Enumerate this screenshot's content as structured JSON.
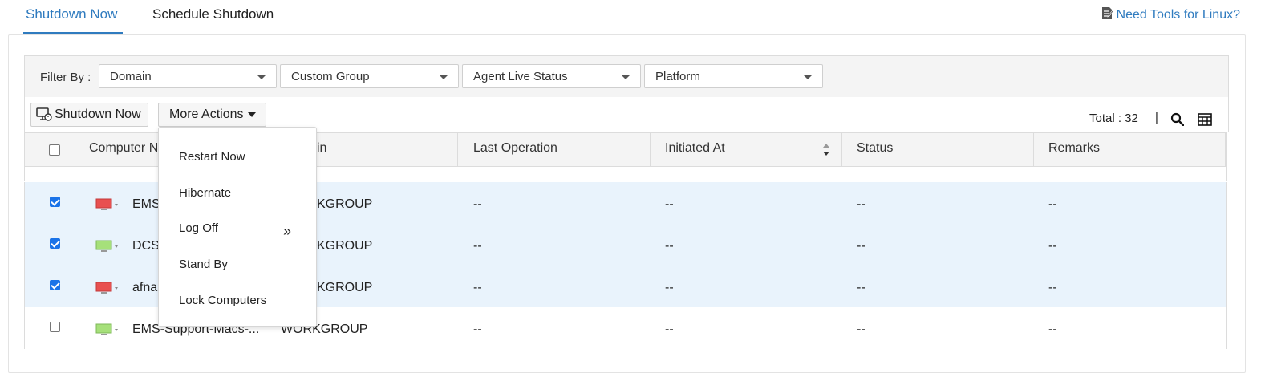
{
  "tabs": [
    {
      "label": "Shutdown Now",
      "active": true
    },
    {
      "label": "Schedule Shutdown",
      "active": false
    }
  ],
  "linux_link": {
    "label": "Need Tools for Linux?",
    "icon": "edit-note-icon"
  },
  "filter": {
    "label": "Filter By :",
    "selects": [
      {
        "value": "Domain"
      },
      {
        "value": "Custom Group"
      },
      {
        "value": "Agent Live Status"
      },
      {
        "value": "Platform"
      }
    ]
  },
  "actions": {
    "shutdown_label": "Shutdown Now",
    "more_label": "More Actions"
  },
  "total": {
    "text": "Total : 32",
    "separator": "|"
  },
  "table": {
    "columns": [
      "Computer Name",
      "Domain",
      "Last Operation",
      "Initiated At",
      "Status",
      "Remarks"
    ],
    "columns_visible": [
      "Computer N",
      "in",
      "Last Operation",
      "Initiated At",
      "Status",
      "Remarks"
    ],
    "rows": [
      {
        "checked": true,
        "status_color": "#e85050",
        "name": "EMS",
        "domain": "KGROUP",
        "last_op": "--",
        "initiated": "--",
        "status": "--",
        "remarks": "--"
      },
      {
        "checked": true,
        "status_color": "#a6e07a",
        "name": "DCS",
        "domain": "KGROUP",
        "last_op": "--",
        "initiated": "--",
        "status": "--",
        "remarks": "--"
      },
      {
        "checked": true,
        "status_color": "#e85050",
        "name": "afna",
        "domain": "KGROUP",
        "last_op": "--",
        "initiated": "--",
        "status": "--",
        "remarks": "--"
      },
      {
        "checked": false,
        "status_color": "#a6e07a",
        "name": "EMS-Support-Macs-...",
        "domain": "WORKGROUP",
        "last_op": "--",
        "initiated": "--",
        "status": "--",
        "remarks": "--"
      }
    ]
  },
  "menu": {
    "items": [
      "Restart Now",
      "Hibernate",
      "Log Off",
      "Stand By",
      "Lock Computers"
    ],
    "submenu_marker": "»"
  },
  "colors": {
    "accent": "#2f7bbf",
    "selected_row": "#e9f3fc",
    "offline": "#e85050",
    "online": "#a6e07a"
  }
}
